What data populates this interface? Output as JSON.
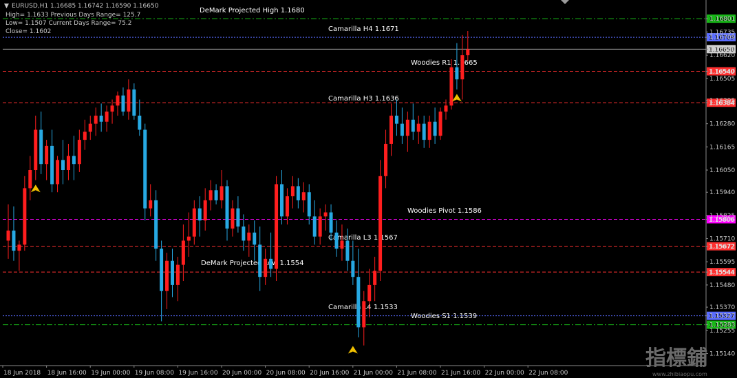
{
  "header": {
    "symbol_line": "EURUSD,H1  1.16685 1.16742 1.16590 1.16650",
    "info_rows": [
      "High= 1.1633     Previous Days Range= 125.7",
      "Low= 1.1507     Current Days Range= 75.2",
      "Close= 1.1602"
    ]
  },
  "watermark": {
    "text": "指標鋪",
    "url": "www.zhibiaopu.com"
  },
  "colors": {
    "background": "#000000",
    "bull": "#ff1e1e",
    "bear": "#27a9e3",
    "demark_line": "#18b818",
    "camarilla_line": "#5a6cff",
    "woodies_line": "#ff3030",
    "pivot_line": "#ff00ff",
    "current_price": "#b4b4b4"
  },
  "chart_data": {
    "type": "candlestick",
    "ylim": [
      1.1508,
      1.1688
    ],
    "y_ticks": [
      "1.16801",
      "1.16735",
      "1.16709",
      "1.16650",
      "1.16620",
      "1.16540",
      "1.16505",
      "1.16395",
      "1.16384",
      "1.16280",
      "1.16165",
      "1.16050",
      "1.15940",
      "1.15825",
      "1.15806",
      "1.15710",
      "1.15672",
      "1.15595",
      "1.15544",
      "1.15480",
      "1.15370",
      "1.15327",
      "1.15283",
      "1.15255",
      "1.15140"
    ],
    "x_labels": [
      "18 Jun 2018",
      "18 Jun 16:00",
      "19 Jun 00:00",
      "19 Jun 08:00",
      "19 Jun 16:00",
      "20 Jun 00:00",
      "20 Jun 08:00",
      "20 Jun 16:00",
      "21 Jun 00:00",
      "21 Jun 08:00",
      "21 Jun 16:00",
      "22 Jun 00:00",
      "22 Jun 08:00"
    ],
    "levels": [
      {
        "label": "DeMark Projected High 1.1680",
        "price": 1.16801,
        "tag": "1.16801",
        "kind": "demark",
        "dash": "dashdot"
      },
      {
        "label": "Camarilla H4 1.1671",
        "price": 1.16709,
        "tag": "1.16709",
        "kind": "camarilla",
        "dash": "dot"
      },
      {
        "label": "Woodies R1 1.1665",
        "price": 1.1654,
        "tag": "1.16540",
        "kind": "woodies",
        "dash": "dash"
      },
      {
        "label": "Camarilla H3 1.1636",
        "price": 1.16384,
        "tag": "1.16384",
        "kind": "woodies",
        "dash": "dash"
      },
      {
        "label": "Woodies Pivot 1.1586",
        "price": 1.15806,
        "tag": "1.15806",
        "kind": "pivot",
        "dash": "dash"
      },
      {
        "label": "Camarilla L3 1.1567",
        "price": 1.15672,
        "tag": "1.15672",
        "kind": "woodies",
        "dash": "dash"
      },
      {
        "label": "DeMark Projected Low 1.1554",
        "price": 1.15544,
        "tag": "1.15544",
        "kind": "woodies",
        "dash": "dash"
      },
      {
        "label": "Camarilla L4 1.1533",
        "price": 1.15327,
        "tag": "1.15327",
        "kind": "camarilla",
        "dash": "dot"
      },
      {
        "label": "Woodies S1 1.1539",
        "price": 1.15283,
        "tag": "1.15283",
        "kind": "demark",
        "dash": "dashdot"
      }
    ],
    "current_price": {
      "price": 1.1665,
      "tag": "1.16650"
    },
    "candles": [
      [
        1.157,
        1.1588,
        1.1561,
        1.1575
      ],
      [
        1.1575,
        1.1587,
        1.156,
        1.1565
      ],
      [
        1.1565,
        1.157,
        1.1555,
        1.1568
      ],
      [
        1.1568,
        1.1602,
        1.1565,
        1.1596
      ],
      [
        1.1596,
        1.1612,
        1.159,
        1.1605
      ],
      [
        1.1605,
        1.1632,
        1.16,
        1.1625
      ],
      [
        1.1625,
        1.1634,
        1.1603,
        1.1608
      ],
      [
        1.1608,
        1.162,
        1.16,
        1.1617
      ],
      [
        1.1617,
        1.1625,
        1.1594,
        1.1598
      ],
      [
        1.1598,
        1.1612,
        1.1594,
        1.161
      ],
      [
        1.161,
        1.162,
        1.1598,
        1.1605
      ],
      [
        1.1605,
        1.1618,
        1.16,
        1.1612
      ],
      [
        1.1612,
        1.1622,
        1.16,
        1.1608
      ],
      [
        1.1608,
        1.1625,
        1.1604,
        1.162
      ],
      [
        1.162,
        1.163,
        1.1615,
        1.1624
      ],
      [
        1.1624,
        1.1632,
        1.162,
        1.1628
      ],
      [
        1.1628,
        1.1636,
        1.1622,
        1.1632
      ],
      [
        1.1632,
        1.1638,
        1.1624,
        1.1629
      ],
      [
        1.1629,
        1.1637,
        1.1624,
        1.1634
      ],
      [
        1.1634,
        1.164,
        1.1628,
        1.1637
      ],
      [
        1.1637,
        1.1644,
        1.1632,
        1.1642
      ],
      [
        1.1642,
        1.1646,
        1.1632,
        1.1634
      ],
      [
        1.1634,
        1.165,
        1.163,
        1.1645
      ],
      [
        1.1645,
        1.1648,
        1.163,
        1.1632
      ],
      [
        1.1632,
        1.164,
        1.1622,
        1.1625
      ],
      [
        1.1625,
        1.1628,
        1.158,
        1.1586
      ],
      [
        1.1586,
        1.1598,
        1.1582,
        1.159
      ],
      [
        1.159,
        1.1595,
        1.156,
        1.1566
      ],
      [
        1.1566,
        1.157,
        1.153,
        1.1545
      ],
      [
        1.1545,
        1.1564,
        1.1536,
        1.156
      ],
      [
        1.156,
        1.1566,
        1.1542,
        1.1548
      ],
      [
        1.1548,
        1.1562,
        1.154,
        1.1558
      ],
      [
        1.1558,
        1.1578,
        1.155,
        1.157
      ],
      [
        1.157,
        1.1584,
        1.1562,
        1.1572
      ],
      [
        1.1572,
        1.159,
        1.1568,
        1.1586
      ],
      [
        1.1586,
        1.1592,
        1.1572,
        1.158
      ],
      [
        1.158,
        1.1596,
        1.1575,
        1.159
      ],
      [
        1.159,
        1.16,
        1.1585,
        1.1595
      ],
      [
        1.1595,
        1.1598,
        1.1588,
        1.159
      ],
      [
        1.159,
        1.1605,
        1.1586,
        1.1597
      ],
      [
        1.1597,
        1.16,
        1.157,
        1.1576
      ],
      [
        1.1576,
        1.159,
        1.1572,
        1.1586
      ],
      [
        1.1586,
        1.1592,
        1.1574,
        1.1577
      ],
      [
        1.1577,
        1.1583,
        1.1565,
        1.157
      ],
      [
        1.157,
        1.1578,
        1.1562,
        1.1574
      ],
      [
        1.1574,
        1.158,
        1.156,
        1.1568
      ],
      [
        1.1568,
        1.1577,
        1.1545,
        1.1552
      ],
      [
        1.1552,
        1.1566,
        1.1548,
        1.1561
      ],
      [
        1.1561,
        1.1574,
        1.1552,
        1.1556
      ],
      [
        1.1556,
        1.1602,
        1.155,
        1.1598
      ],
      [
        1.1598,
        1.1605,
        1.1578,
        1.1582
      ],
      [
        1.1582,
        1.1596,
        1.1578,
        1.1592
      ],
      [
        1.1592,
        1.1602,
        1.1586,
        1.1597
      ],
      [
        1.1597,
        1.1601,
        1.1586,
        1.159
      ],
      [
        1.159,
        1.1599,
        1.1584,
        1.1594
      ],
      [
        1.1594,
        1.1598,
        1.1578,
        1.1582
      ],
      [
        1.1582,
        1.159,
        1.1568,
        1.1572
      ],
      [
        1.1572,
        1.1586,
        1.1568,
        1.1582
      ],
      [
        1.1582,
        1.1588,
        1.1575,
        1.1584
      ],
      [
        1.1584,
        1.1588,
        1.157,
        1.1574
      ],
      [
        1.1574,
        1.158,
        1.1562,
        1.1566
      ],
      [
        1.1566,
        1.1578,
        1.156,
        1.157
      ],
      [
        1.157,
        1.1576,
        1.1555,
        1.156
      ],
      [
        1.156,
        1.157,
        1.1548,
        1.1552
      ],
      [
        1.1552,
        1.1566,
        1.1522,
        1.1527
      ],
      [
        1.1527,
        1.1545,
        1.1518,
        1.154
      ],
      [
        1.154,
        1.1556,
        1.1532,
        1.1548
      ],
      [
        1.1548,
        1.1562,
        1.154,
        1.1555
      ],
      [
        1.1555,
        1.161,
        1.155,
        1.1602
      ],
      [
        1.1602,
        1.1625,
        1.1596,
        1.1618
      ],
      [
        1.1618,
        1.1638,
        1.1612,
        1.1632
      ],
      [
        1.1632,
        1.164,
        1.1622,
        1.1628
      ],
      [
        1.1628,
        1.1636,
        1.1618,
        1.1622
      ],
      [
        1.1622,
        1.1634,
        1.1614,
        1.163
      ],
      [
        1.163,
        1.1638,
        1.162,
        1.1624
      ],
      [
        1.1624,
        1.1632,
        1.1618,
        1.1628
      ],
      [
        1.1628,
        1.1632,
        1.1616,
        1.162
      ],
      [
        1.162,
        1.1632,
        1.1616,
        1.1629
      ],
      [
        1.1629,
        1.1636,
        1.1618,
        1.1622
      ],
      [
        1.1622,
        1.1636,
        1.162,
        1.1634
      ],
      [
        1.1634,
        1.164,
        1.163,
        1.1637
      ],
      [
        1.1637,
        1.166,
        1.1635,
        1.1656
      ],
      [
        1.1656,
        1.1668,
        1.1645,
        1.165
      ],
      [
        1.165,
        1.1672,
        1.164,
        1.1662
      ],
      [
        1.1662,
        1.1674,
        1.1659,
        1.1665
      ]
    ],
    "arrows": [
      {
        "index": 5,
        "price": 1.1595,
        "dir": "up",
        "color": "#f0c000"
      },
      {
        "index": 63,
        "price": 1.1515,
        "dir": "up",
        "color": "#f0c000"
      },
      {
        "index": 82,
        "price": 1.164,
        "dir": "up",
        "color": "#f0c000"
      }
    ]
  }
}
